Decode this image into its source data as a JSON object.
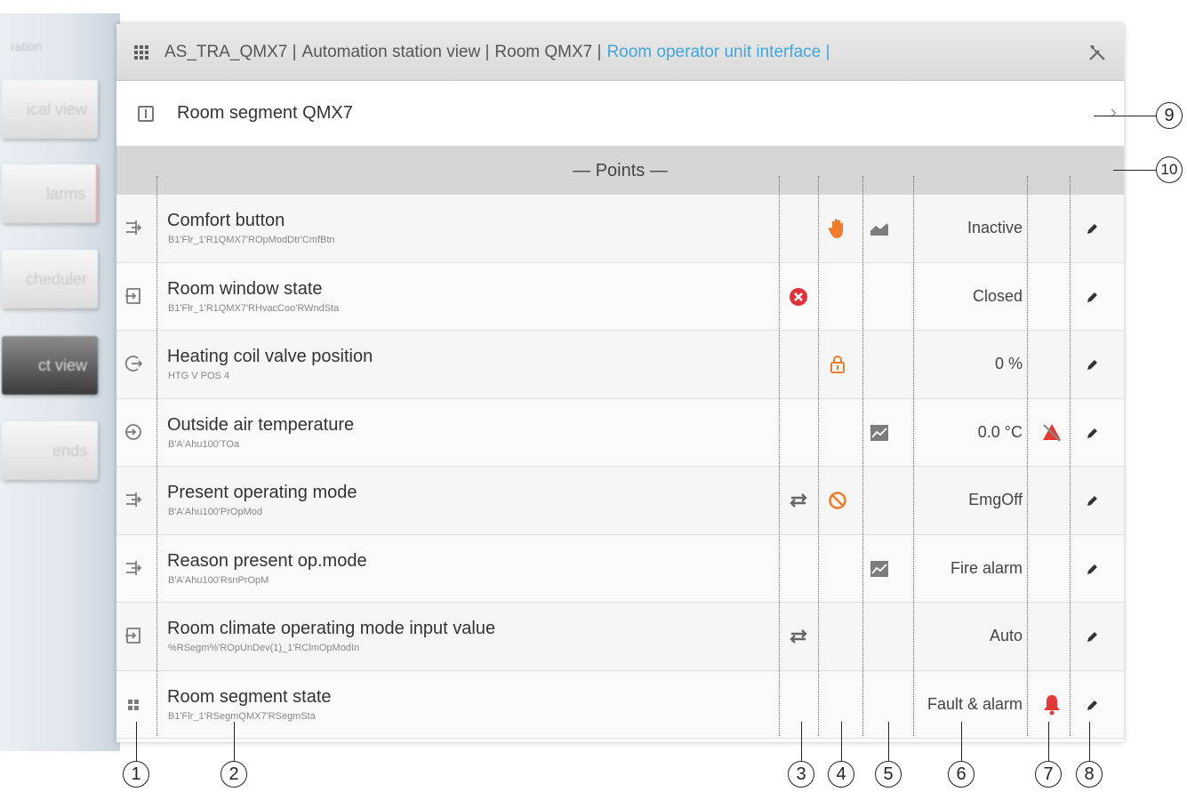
{
  "side_nav": {
    "title": "ration",
    "items": [
      {
        "label": "ical view",
        "active": false
      },
      {
        "label": "larms",
        "active": false
      },
      {
        "label": "cheduler",
        "active": false
      },
      {
        "label": "ct view",
        "active": true
      },
      {
        "label": "ends",
        "active": false
      }
    ]
  },
  "header": {
    "grid_icon": "apps-grid-icon",
    "breadcrumb": [
      {
        "label": "AS_TRA_QMX7 |"
      },
      {
        "label": "Automation station view |"
      },
      {
        "label": "Room QMX7 |"
      },
      {
        "label": "Room operator unit interface |",
        "current": true
      }
    ],
    "tools_icon": "tools-icon",
    "accent_color": "#41a5e0"
  },
  "segment": {
    "label": "Room segment QMX7",
    "icon": "panel-icon",
    "chevron": "›"
  },
  "points_header": "— Points —",
  "rows": [
    {
      "name": "Comfort button",
      "address": "B1'Flr_1'R1QMX7'ROpModDtr'CmfBtn",
      "value": "Inactive",
      "type_icon": "multistate-io-icon",
      "c3": "",
      "c4": "hand-override-icon",
      "c5": "trend-chart-icon",
      "c7": ""
    },
    {
      "name": "Room window state",
      "address": "B1'Flr_1'R1QMX7'RHvacCoo'RWndSta",
      "value": "Closed",
      "type_icon": "binary-input-icon",
      "c3": "error-x-icon",
      "c4": "",
      "c5": "",
      "c7": ""
    },
    {
      "name": "Heating coil valve position",
      "address": "HTG V POS 4",
      "value": "0 %",
      "type_icon": "analog-output-icon",
      "c3": "",
      "c4": "lock-icon",
      "c5": "",
      "c7": ""
    },
    {
      "name": "Outside air temperature",
      "address": "B'A'Ahu100'TOa",
      "value": "0.0 °C",
      "type_icon": "analog-input-icon",
      "c3": "",
      "c4": "",
      "c5": "trend-chart-icon",
      "c7": "alarm-muted-icon"
    },
    {
      "name": "Present operating mode",
      "address": "B'A'Ahu100'PrOpMod",
      "value": "EmgOff",
      "type_icon": "multistate-io-icon",
      "c3": "transfer-arrows-icon",
      "c4": "blocked-icon",
      "c5": "",
      "c7": ""
    },
    {
      "name": "Reason present op.mode",
      "address": "B'A'Ahu100'RsnPrOpM",
      "value": "Fire alarm",
      "type_icon": "multistate-io-icon",
      "c3": "",
      "c4": "",
      "c5": "trend-chart-icon",
      "c7": ""
    },
    {
      "name": "Room climate operating mode input value",
      "address": "%RSegm%'ROpUnDev(1)_1'RClmOpModIn",
      "value": "Auto",
      "type_icon": "binary-input-icon",
      "c3": "transfer-arrows-icon",
      "c4": "",
      "c5": "",
      "c7": ""
    },
    {
      "name": "Room segment state",
      "address": "B1'Flr_1'RSegmQMX7'RSegmSta",
      "value": "Fault & alarm",
      "type_icon": "segment-state-icon",
      "c3": "",
      "c4": "",
      "c5": "",
      "c7": "alarm-bell-icon"
    }
  ],
  "edit_icon": "edit-pencil-icon",
  "callouts": [
    "1",
    "2",
    "3",
    "4",
    "5",
    "6",
    "7",
    "8",
    "9",
    "10"
  ],
  "colors": {
    "alarm_red": "#e53935",
    "override_orange": "#f07d2d",
    "error_red": "#e0303a",
    "icon_gray": "#7c7c7c"
  }
}
